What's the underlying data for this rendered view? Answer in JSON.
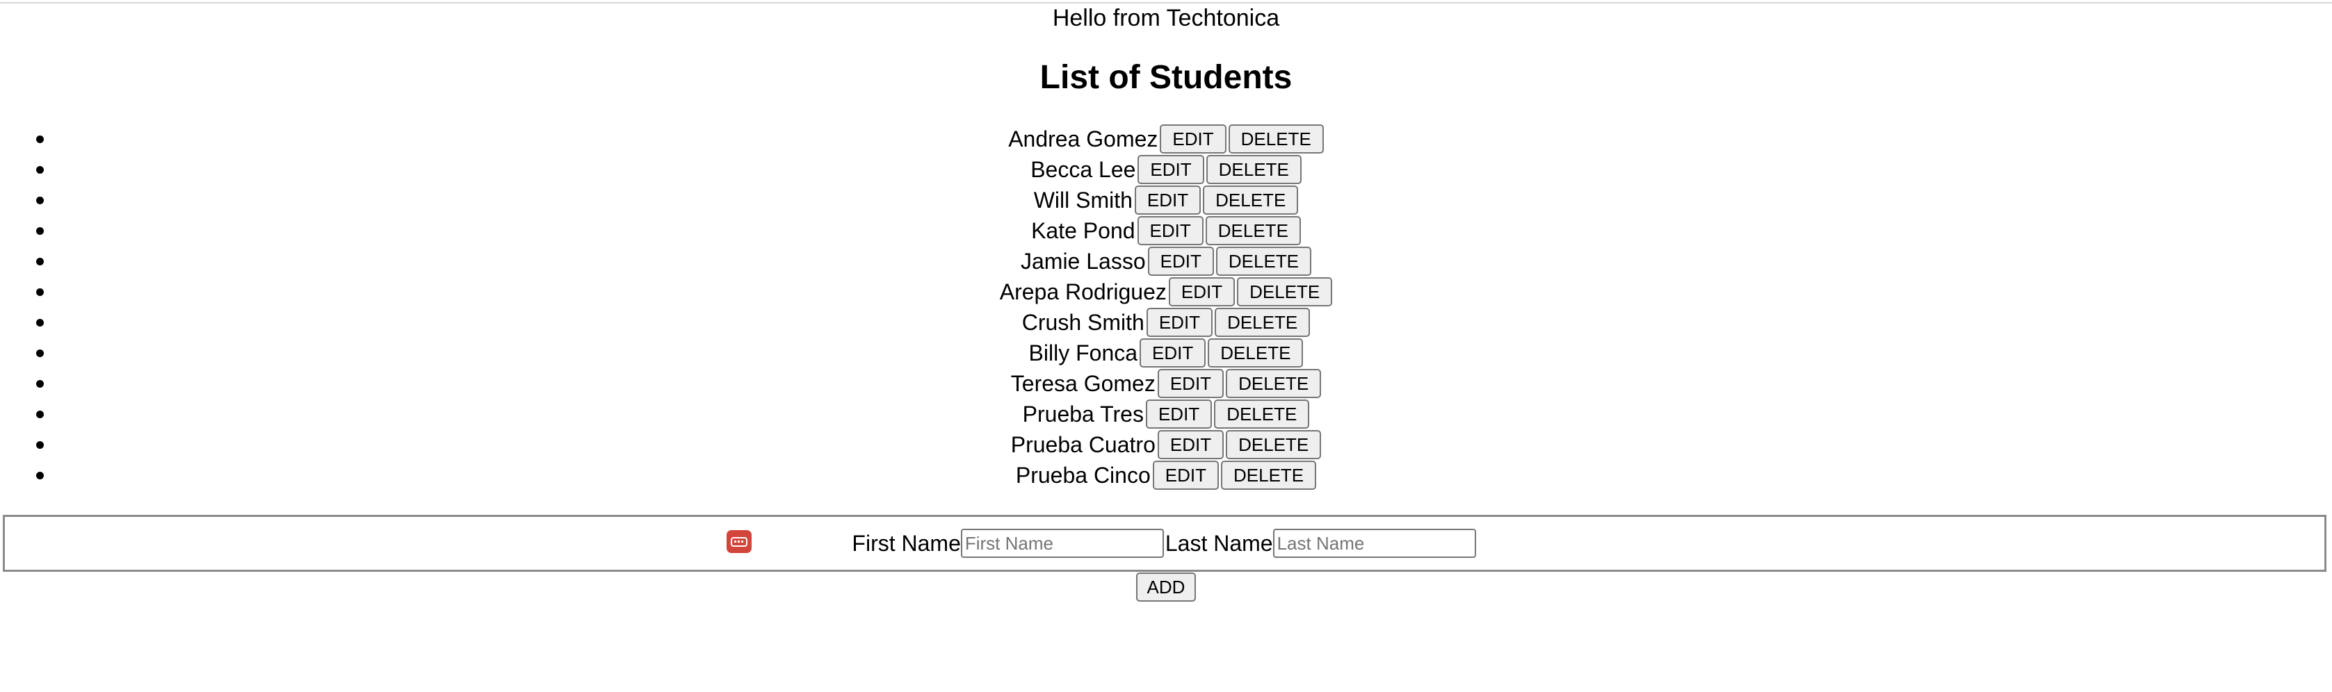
{
  "page": {
    "greeting": "Hello from Techtonica",
    "heading": "List of Students"
  },
  "students": [
    {
      "name": "Andrea Gomez"
    },
    {
      "name": "Becca Lee"
    },
    {
      "name": "Will Smith"
    },
    {
      "name": "Kate Pond"
    },
    {
      "name": "Jamie Lasso"
    },
    {
      "name": "Arepa Rodriguez"
    },
    {
      "name": "Crush Smith"
    },
    {
      "name": "Billy Fonca"
    },
    {
      "name": "Teresa Gomez"
    },
    {
      "name": "Prueba Tres"
    },
    {
      "name": "Prueba Cuatro"
    },
    {
      "name": "Prueba Cinco"
    }
  ],
  "buttons": {
    "edit_label": "EDIT",
    "delete_label": "DELETE",
    "add_label": "ADD"
  },
  "form": {
    "first_name_label": "First Name",
    "first_name_placeholder": "First Name",
    "first_name_value": "",
    "last_name_label": "Last Name",
    "last_name_placeholder": "Last Name",
    "last_name_value": ""
  },
  "icons": {
    "extension_icon": "password-manager-icon",
    "extension_color": "#d2453b"
  }
}
